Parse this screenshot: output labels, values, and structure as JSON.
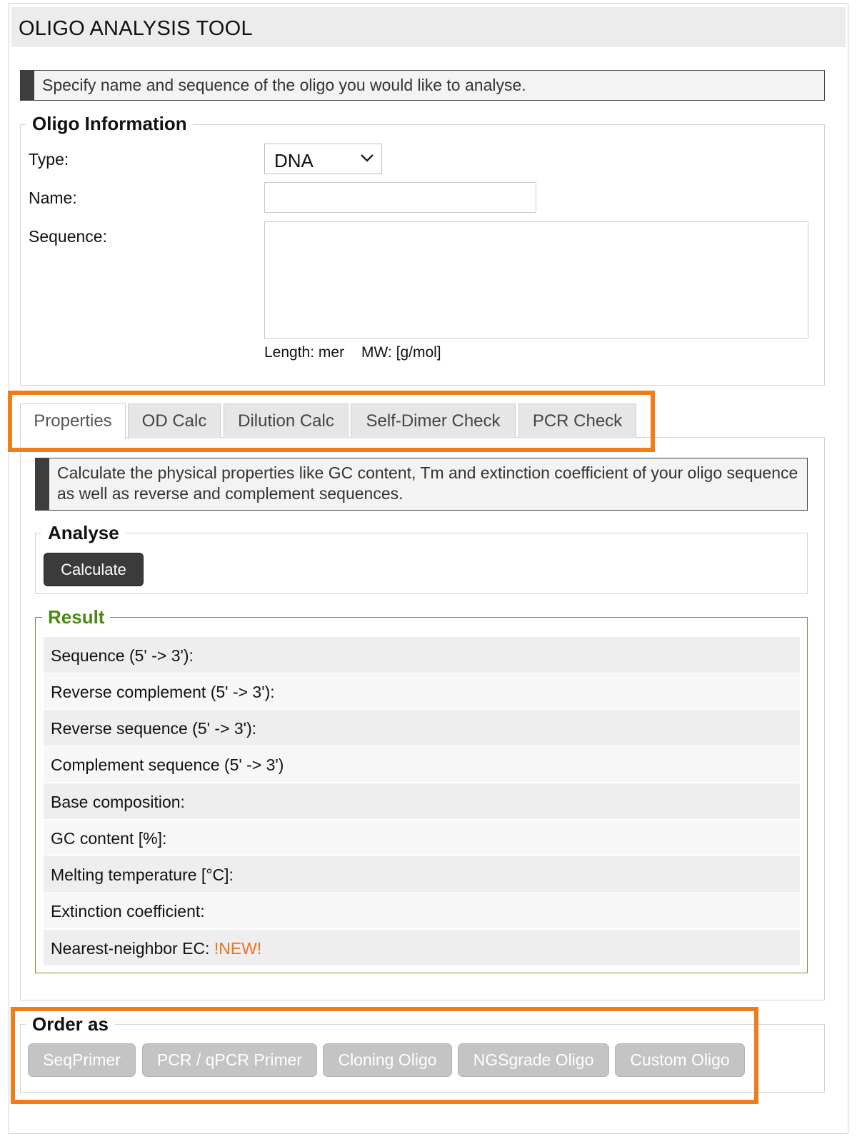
{
  "app": {
    "title": "OLIGO ANALYSIS TOOL"
  },
  "intro_hint": "Specify name and sequence of the oligo you would like to analyse.",
  "oligo_info": {
    "legend": "Oligo Information",
    "type_label": "Type:",
    "type_value": "DNA",
    "name_label": "Name:",
    "name_value": "",
    "sequence_label": "Sequence:",
    "sequence_value": "",
    "length_text": "Length: mer",
    "mw_text": "MW: [g/mol]"
  },
  "tabs": [
    {
      "label": "Properties",
      "active": true
    },
    {
      "label": "OD Calc",
      "active": false
    },
    {
      "label": "Dilution Calc",
      "active": false
    },
    {
      "label": "Self-Dimer Check",
      "active": false
    },
    {
      "label": "PCR Check",
      "active": false
    }
  ],
  "properties_hint": "Calculate the physical properties like GC content, Tm and extinction coefficient of your oligo sequence as well as reverse and complement sequences.",
  "analyse": {
    "legend": "Analyse",
    "button": "Calculate"
  },
  "result": {
    "legend": "Result",
    "rows": [
      "Sequence (5' -> 3'):",
      "Reverse complement (5' -> 3'):",
      "Reverse sequence (5' -> 3'):",
      "Complement sequence (5' -> 3')",
      "Base composition:",
      "GC content [%]:",
      "Melting temperature [°C]:",
      "Extinction coefficient:",
      "Nearest-neighbor EC:"
    ],
    "new_badge": "!NEW!"
  },
  "order": {
    "legend": "Order as",
    "buttons": [
      "SeqPrimer",
      "PCR / qPCR Primer",
      "Cloning Oligo",
      "NGSgrade Oligo",
      "Custom Oligo"
    ]
  },
  "colors": {
    "highlight": "#f07d18",
    "result_green": "#4a8a14",
    "new_orange": "#f07020",
    "dark_button": "#3b3b3b"
  }
}
